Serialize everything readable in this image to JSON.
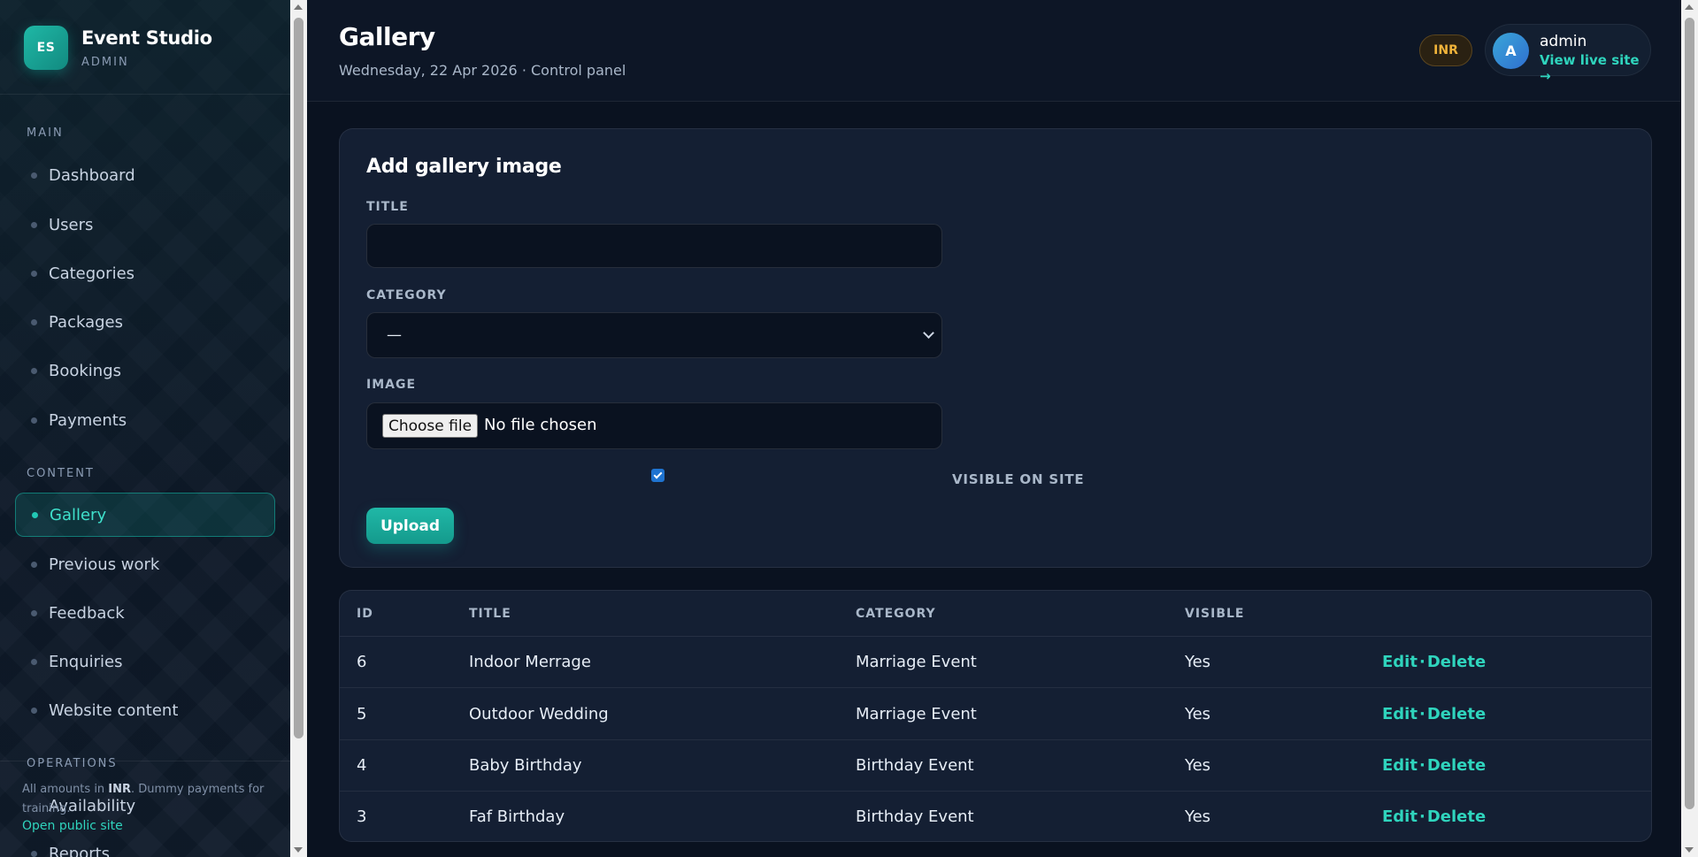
{
  "brand": {
    "initials": "ES",
    "name": "Event Studio",
    "role": "ADMIN"
  },
  "sidebar": {
    "sections": [
      {
        "title": "MAIN",
        "items": [
          "Dashboard",
          "Users",
          "Categories",
          "Packages",
          "Bookings",
          "Payments"
        ]
      },
      {
        "title": "CONTENT",
        "items": [
          "Gallery",
          "Previous work",
          "Feedback",
          "Enquiries",
          "Website content"
        ]
      },
      {
        "title": "OPERATIONS",
        "items": [
          "Availability",
          "Reports"
        ]
      }
    ],
    "active": "Gallery",
    "footer": {
      "note_prefix": "All amounts in ",
      "note_currency": "INR",
      "note_suffix": ". Dummy payments for training.",
      "link": "Open public site"
    }
  },
  "header": {
    "title": "Gallery",
    "subtitle": "Wednesday, 22 Apr 2026 · Control panel",
    "currency": "INR",
    "user": {
      "initial": "A",
      "name": "admin",
      "link": "View live site →"
    }
  },
  "form": {
    "title": "Add gallery image",
    "title_label": "TITLE",
    "title_value": "",
    "category_label": "CATEGORY",
    "category_value": "—",
    "image_label": "IMAGE",
    "file_button": "Choose file",
    "file_status": "No file chosen",
    "visible_checked": true,
    "visible_label": "VISIBLE ON SITE",
    "submit": "Upload"
  },
  "table": {
    "columns": [
      "ID",
      "TITLE",
      "CATEGORY",
      "VISIBLE"
    ],
    "rows": [
      {
        "id": "6",
        "title": "Indoor Merrage",
        "category": "Marriage Event",
        "visible": "Yes"
      },
      {
        "id": "5",
        "title": "Outdoor Wedding",
        "category": "Marriage Event",
        "visible": "Yes"
      },
      {
        "id": "4",
        "title": "Baby Birthday",
        "category": "Birthday Event",
        "visible": "Yes"
      },
      {
        "id": "3",
        "title": "Faf Birthday",
        "category": "Birthday Event",
        "visible": "Yes"
      }
    ],
    "edit_label": "Edit",
    "delete_label": "Delete",
    "action_separator": "·"
  },
  "colors": {
    "accent": "#20b8a7",
    "link": "#2fd4bd",
    "badge": "#f0b33a",
    "background": "#0a1220",
    "card": "#141f33"
  }
}
